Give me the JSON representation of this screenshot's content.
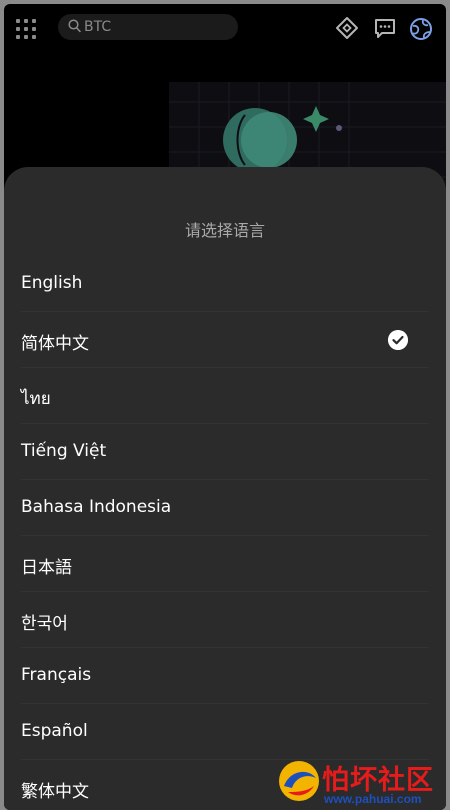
{
  "topbar": {
    "search_value": "BTC",
    "icons": [
      "grid-menu-icon",
      "search-icon",
      "ticket-icon",
      "chat-icon",
      "globe-icon"
    ]
  },
  "sheet": {
    "title": "请选择语言",
    "languages": [
      {
        "label": "English",
        "selected": false
      },
      {
        "label": "简体中文",
        "selected": true
      },
      {
        "label": "ไทย",
        "selected": false
      },
      {
        "label": "Tiếng Việt",
        "selected": false
      },
      {
        "label": "Bahasa Indonesia",
        "selected": false
      },
      {
        "label": "日本語",
        "selected": false
      },
      {
        "label": "한국어",
        "selected": false
      },
      {
        "label": "Français",
        "selected": false
      },
      {
        "label": "Español",
        "selected": false
      },
      {
        "label": "繁体中文",
        "selected": false
      }
    ]
  },
  "watermark": {
    "text": "怕坏社区",
    "url": "www.pahuai.com"
  },
  "colors": {
    "background": "#000000",
    "sheet": "#2b2b2b",
    "text": "#ffffff",
    "title": "#a9a9a9",
    "accent_green": "#3a7a6a",
    "watermark_red": "#e61c1c",
    "watermark_blue": "#1e4fbf"
  }
}
